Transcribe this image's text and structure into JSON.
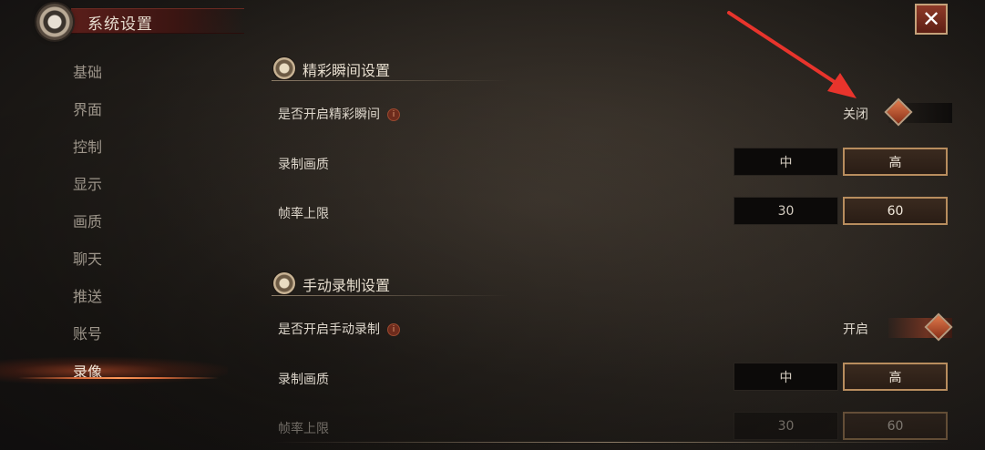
{
  "header": {
    "title": "系统设置"
  },
  "sidebar": {
    "items": [
      {
        "label": "基础"
      },
      {
        "label": "界面"
      },
      {
        "label": "控制"
      },
      {
        "label": "显示"
      },
      {
        "label": "画质"
      },
      {
        "label": "聊天"
      },
      {
        "label": "推送"
      },
      {
        "label": "账号"
      },
      {
        "label": "录像"
      }
    ],
    "active": "录像"
  },
  "highlight": {
    "title": "精彩瞬间设置",
    "enable_label": "是否开启精彩瞬间",
    "enable_state": "关闭",
    "quality_label": "录制画质",
    "quality_options": [
      "中",
      "高"
    ],
    "quality_selected": "高",
    "fps_label": "帧率上限",
    "fps_options": [
      "30",
      "60"
    ],
    "fps_selected": "60"
  },
  "manual": {
    "title": "手动录制设置",
    "enable_label": "是否开启手动录制",
    "enable_state": "开启",
    "quality_label": "录制画质",
    "quality_options": [
      "中",
      "高"
    ],
    "quality_selected": "高",
    "fps_label": "帧率上限",
    "fps_options": [
      "30",
      "60"
    ],
    "fps_selected": "60"
  },
  "icons": {
    "info": "i",
    "close": "✕"
  },
  "colors": {
    "accent": "#b88d5e",
    "close_button": "#8e3a28",
    "annotation_arrow": "#e8342c"
  }
}
